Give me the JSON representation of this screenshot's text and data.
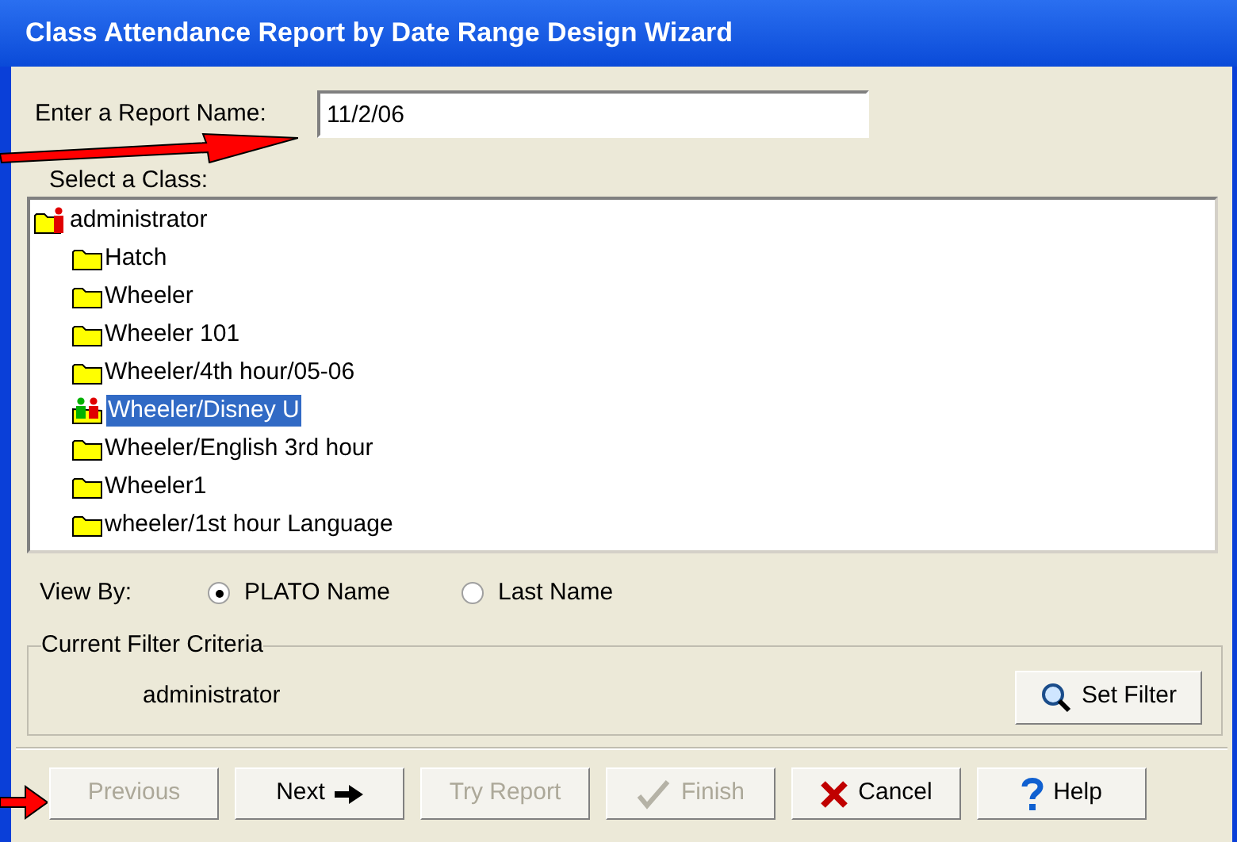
{
  "window": {
    "title": "Class Attendance Report by Date Range Design Wizard"
  },
  "report_name": {
    "label": "Enter a Report Name:",
    "value": "11/2/06"
  },
  "class_tree": {
    "label": "Select a Class:",
    "root": {
      "label": "administrator",
      "kind": "admin",
      "selected": false,
      "children": [
        {
          "label": "Hatch",
          "kind": "folder",
          "selected": false
        },
        {
          "label": "Wheeler",
          "kind": "folder",
          "selected": false
        },
        {
          "label": "Wheeler 101",
          "kind": "folder",
          "selected": false
        },
        {
          "label": "Wheeler/4th hour/05-06",
          "kind": "folder",
          "selected": false
        },
        {
          "label": "Wheeler/Disney U",
          "kind": "group",
          "selected": true
        },
        {
          "label": "Wheeler/English 3rd hour",
          "kind": "folder",
          "selected": false
        },
        {
          "label": "Wheeler1",
          "kind": "folder",
          "selected": false
        },
        {
          "label": "wheeler/1st hour Language",
          "kind": "folder",
          "selected": false
        }
      ]
    }
  },
  "view_by": {
    "label": "View By:",
    "options": [
      {
        "label": "PLATO Name",
        "selected": true
      },
      {
        "label": "Last Name",
        "selected": false
      }
    ]
  },
  "filter": {
    "title": "Current Filter Criteria",
    "value": "administrator",
    "button": "Set Filter"
  },
  "buttons": [
    {
      "label": "Previous",
      "disabled": true
    },
    {
      "label": "Next",
      "disabled": false
    },
    {
      "label": "Try Report",
      "disabled": true
    },
    {
      "label": "Finish",
      "disabled": true
    },
    {
      "label": "Cancel",
      "disabled": false
    },
    {
      "label": "Help",
      "disabled": false
    }
  ]
}
